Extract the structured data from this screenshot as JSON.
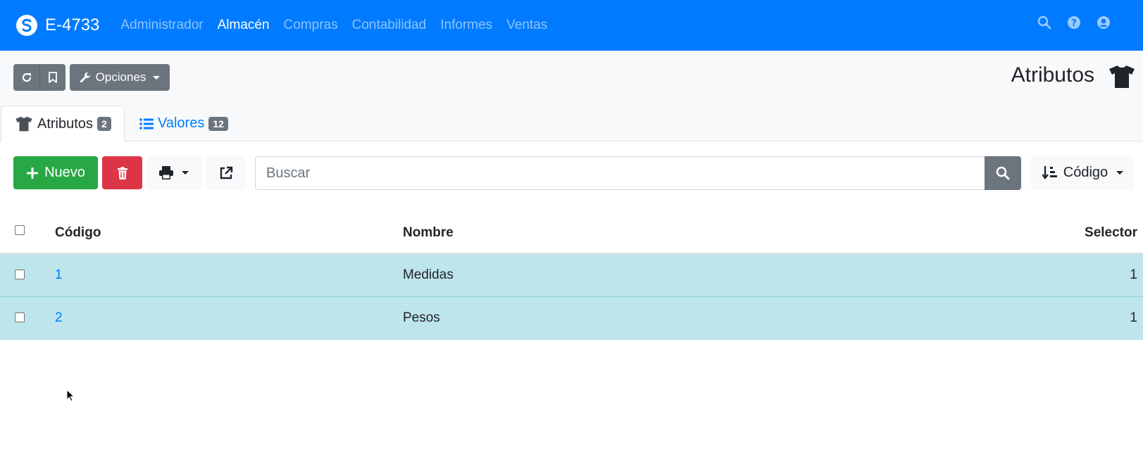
{
  "navbar": {
    "brand": "E-4733",
    "menu": [
      {
        "label": "Administrador",
        "active": false
      },
      {
        "label": "Almacén",
        "active": true
      },
      {
        "label": "Compras",
        "active": false
      },
      {
        "label": "Contabilidad",
        "active": false
      },
      {
        "label": "Informes",
        "active": false
      },
      {
        "label": "Ventas",
        "active": false
      }
    ],
    "icons": [
      "search-icon",
      "help-icon",
      "user-icon"
    ]
  },
  "toolbar": {
    "options_label": "Opciones",
    "page_title": "Atributos"
  },
  "tabs": [
    {
      "label": "Atributos",
      "count": "2",
      "active": true
    },
    {
      "label": "Valores",
      "count": "12",
      "active": false
    }
  ],
  "actions": {
    "new_label": "Nuevo",
    "search_placeholder": "Buscar",
    "sort_label": "Código"
  },
  "table": {
    "headers": {
      "code": "Código",
      "name": "Nombre",
      "selector": "Selector"
    },
    "rows": [
      {
        "code": "1",
        "name": "Medidas",
        "selector": "1"
      },
      {
        "code": "2",
        "name": "Pesos",
        "selector": "1"
      }
    ]
  },
  "colors": {
    "primary": "#007bff",
    "success": "#28a745",
    "danger": "#dc3545",
    "secondary": "#6c757d",
    "row_highlight": "#bee5eb"
  }
}
